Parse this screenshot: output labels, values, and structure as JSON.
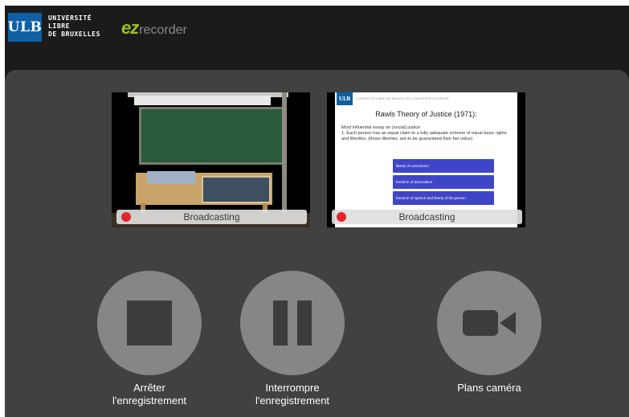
{
  "header": {
    "ulb_logo_text": "ULB",
    "university_lines": [
      "UNIVERSITÉ",
      "LIBRE",
      "DE BRUXELLES"
    ],
    "app_logo": {
      "prefix": "ez",
      "suffix": "recorder"
    },
    "colors": {
      "ulb_blue": "#0f5fa3",
      "ez_green": "#9cc21f"
    }
  },
  "feeds": [
    {
      "id": "camera",
      "status": "Broadcasting",
      "recording_indicator": "red-dot"
    },
    {
      "id": "slides",
      "status": "Broadcasting",
      "recording_indicator": "red-dot",
      "slide": {
        "logo": "ULB",
        "header_line": "UNIVERSITÉ LIBRE DE BRUXELLES, UNIVERSITÉ D'EUROPE",
        "title": "Rawls Theory of Justice (1971):",
        "body": [
          "Most influential essay on (social) justice",
          "1. Each person has an equal claim to a fully adequate scheme of equal basic rights and liberties. (those liberties, are to be guaranteed their fair value)"
        ],
        "boxes": [
          "liberty of conscience",
          "freedom of association",
          "freedom of speech and liberty of the person"
        ]
      }
    }
  ],
  "controls": {
    "stop": {
      "label_line1": "Arrêter",
      "label_line2": "l'enregistrement",
      "icon": "stop-icon"
    },
    "pause": {
      "label_line1": "Interrompre",
      "label_line2": "l'enregistrement",
      "icon": "pause-icon"
    },
    "camera": {
      "label": "Plans caméra",
      "icon": "video-camera-icon"
    }
  },
  "colors": {
    "background": "#1b1b1b",
    "panel": "#414141",
    "button": "#868686",
    "icon": "#3c3c3c",
    "recording": "#e2272c"
  }
}
